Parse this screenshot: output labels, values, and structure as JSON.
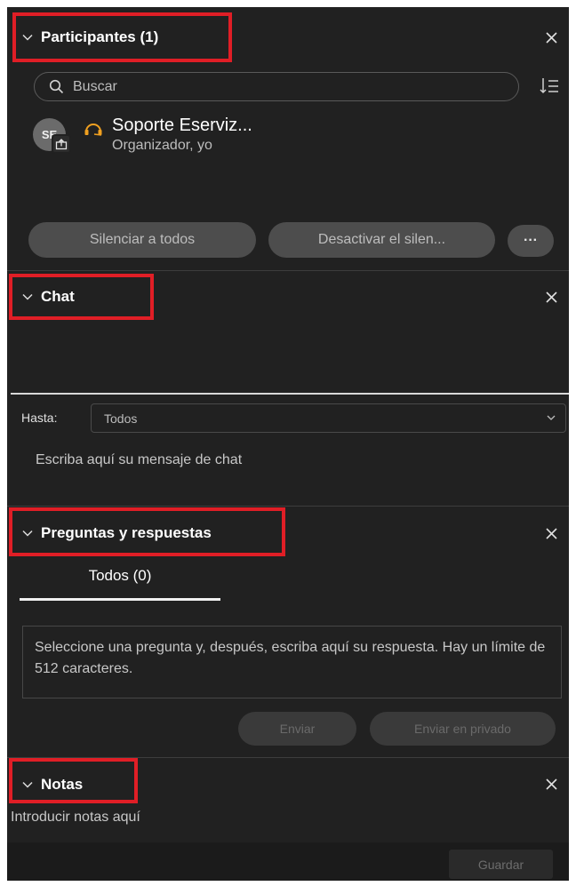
{
  "participants": {
    "title": "Participantes (1)",
    "search_placeholder": "Buscar",
    "list": [
      {
        "initials": "SE",
        "name": "Soporte Eserviz...",
        "role": "Organizador, yo"
      }
    ],
    "mute_all_label": "Silenciar a todos",
    "unmute_all_label": "Desactivar el silen...",
    "more_label": "···"
  },
  "chat": {
    "title": "Chat",
    "to_label": "Hasta:",
    "to_value": "Todos",
    "message_placeholder": "Escriba aquí su mensaje de chat"
  },
  "qa": {
    "title": "Preguntas y respuestas",
    "tab_all": "Todos (0)",
    "answer_placeholder": "Seleccione una pregunta y, después, escriba aquí su respuesta. Hay un límite de 512 caracteres.",
    "send_label": "Enviar",
    "send_private_label": "Enviar en privado"
  },
  "notes": {
    "title": "Notas",
    "placeholder": "Introducir notas aquí",
    "save_label": "Guardar"
  },
  "colors": {
    "panel_bg": "#212121",
    "highlight": "#e01e26",
    "audio_icon": "#f0a020"
  }
}
